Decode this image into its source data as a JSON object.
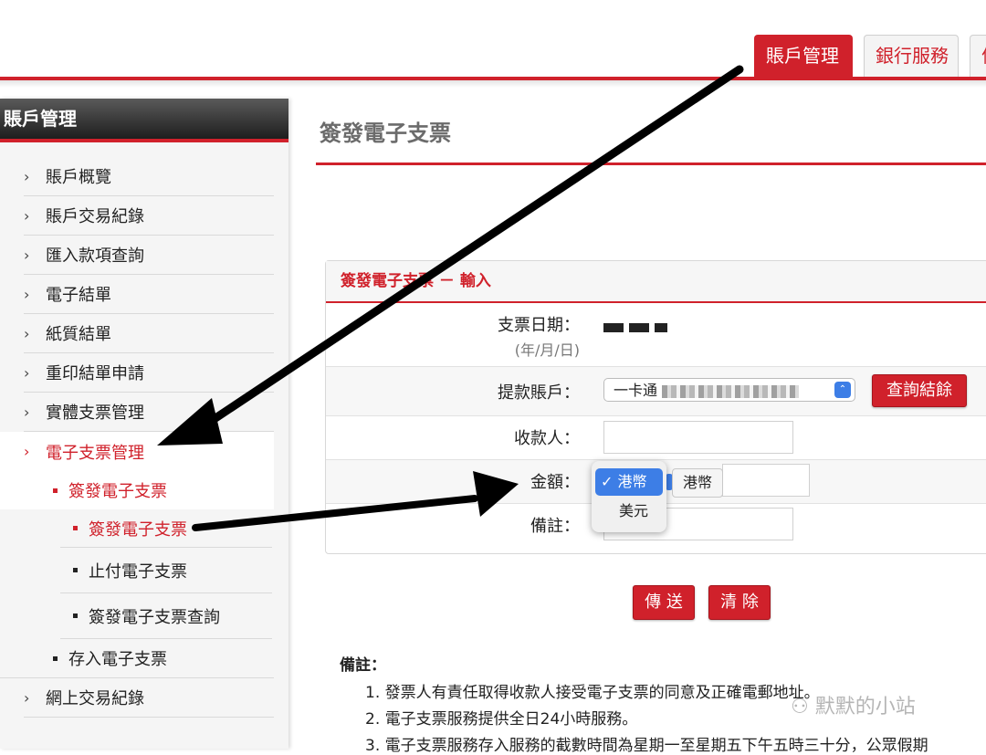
{
  "top_tabs": [
    {
      "label": "賬戶管理",
      "active": true
    },
    {
      "label": "銀行服務",
      "active": false
    },
    {
      "label": "信",
      "active": false
    }
  ],
  "sidebar": {
    "title": "賬戶管理",
    "items": [
      {
        "label": "賬戶概覽"
      },
      {
        "label": "賬戶交易紀錄"
      },
      {
        "label": "匯入款項查詢"
      },
      {
        "label": "電子結單"
      },
      {
        "label": "紙質結單"
      },
      {
        "label": "重印結單申請"
      },
      {
        "label": "實體支票管理"
      }
    ],
    "active_item": {
      "label": "電子支票管理"
    },
    "sub_heading": "簽發電子支票",
    "sub_items": [
      {
        "label": "簽發電子支票"
      },
      {
        "label": "止付電子支票"
      },
      {
        "label": "簽發電子支票查詢"
      }
    ],
    "deposit_item": "存入電子支票",
    "last_item": "網上交易紀錄"
  },
  "main": {
    "page_title": "簽發電子支票",
    "panel_title": "簽發電子支票 － 輸入",
    "fields": {
      "date_label": "支票日期：",
      "date_hint": "(年/月/日)",
      "account_label": "提款賬戶：",
      "account_value": "一卡通",
      "balance_button": "查詢結餘",
      "payee_label": "收款人：",
      "amount_label": "金額：",
      "currency_value": "港幣",
      "remark_label": "備註："
    },
    "currency_options": [
      {
        "label": "✓ 港幣",
        "selected": true
      },
      {
        "label": "美元",
        "selected": false
      }
    ],
    "send_button": "傳 送",
    "clear_button": "清 除"
  },
  "notes": {
    "title": "備註：",
    "items": [
      "1.  發票人有責任取得收款人接受電子支票的同意及正確電郵地址。",
      "2.  電子支票服務提供全日24小時服務。",
      "3.  電子支票服務存入服務的截數時間為星期一至星期五下午五時三十分，公眾假期"
    ]
  },
  "watermark": "默默的小站",
  "colors": {
    "accent": "#d0212b",
    "select_blue": "#3d7ee6"
  }
}
